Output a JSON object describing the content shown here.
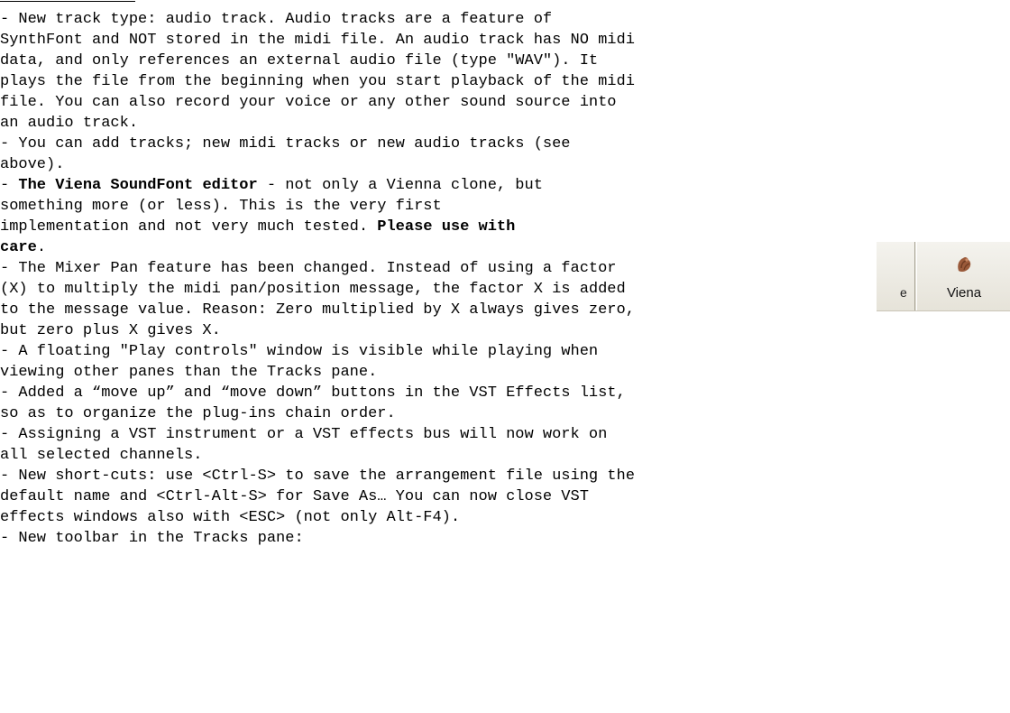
{
  "lines": [
    {
      "text": "- New track type: audio track. Audio tracks are a feature of"
    },
    {
      "text": "SynthFont and NOT stored in the midi file. An audio track has NO midi"
    },
    {
      "text": "data, and only references an external audio file (type \"WAV\"). It"
    },
    {
      "text": "plays the file from the beginning when you start playback of the midi"
    },
    {
      "text": "file. You can also record your voice or any other sound source into"
    },
    {
      "text": "an audio track."
    },
    {
      "text": "- You can add tracks; new midi tracks or new audio tracks (see"
    },
    {
      "text": "above)."
    },
    {
      "prefix": "- ",
      "bold": "The Viena SoundFont editor",
      "suffix": " - not only a Vienna clone, but"
    },
    {
      "text": "something more (or less). This is the very first"
    },
    {
      "prefix": "implementation and not very much tested. ",
      "bold": "Please use with"
    },
    {
      "bold": "care",
      "suffix": "."
    },
    {
      "text": "- The Mixer Pan feature has been changed. Instead of using a factor"
    },
    {
      "text": "(X) to multiply the midi pan/position message, the factor X is added"
    },
    {
      "text": "to the message value. Reason: Zero multiplied by X always gives zero,"
    },
    {
      "text": "but zero plus X gives X."
    },
    {
      "text": "- A floating \"Play controls\" window is visible while playing when"
    },
    {
      "text": "viewing other panes than the Tracks pane."
    },
    {
      "text": "- Added a “move up” and “move down” buttons in the VST Effects list,"
    },
    {
      "text": "so as to organize the plug-ins chain order."
    },
    {
      "text": "- Assigning a VST instrument or a VST effects bus will now work on"
    },
    {
      "text": "all selected channels."
    },
    {
      "text": "- New short-cuts: use <Ctrl-S> to save the arrangement file using the"
    },
    {
      "text": "default name and <Ctrl-Alt-S> for Save As… You can now close VST"
    },
    {
      "text": "effects windows also with <ESC> (not only Alt-F4)."
    },
    {
      "text": "- New toolbar in the Tracks pane:"
    }
  ],
  "toolbar_snippet": {
    "partial_label": "e",
    "button_label": "Viena",
    "button_icon": "viena-icon"
  }
}
